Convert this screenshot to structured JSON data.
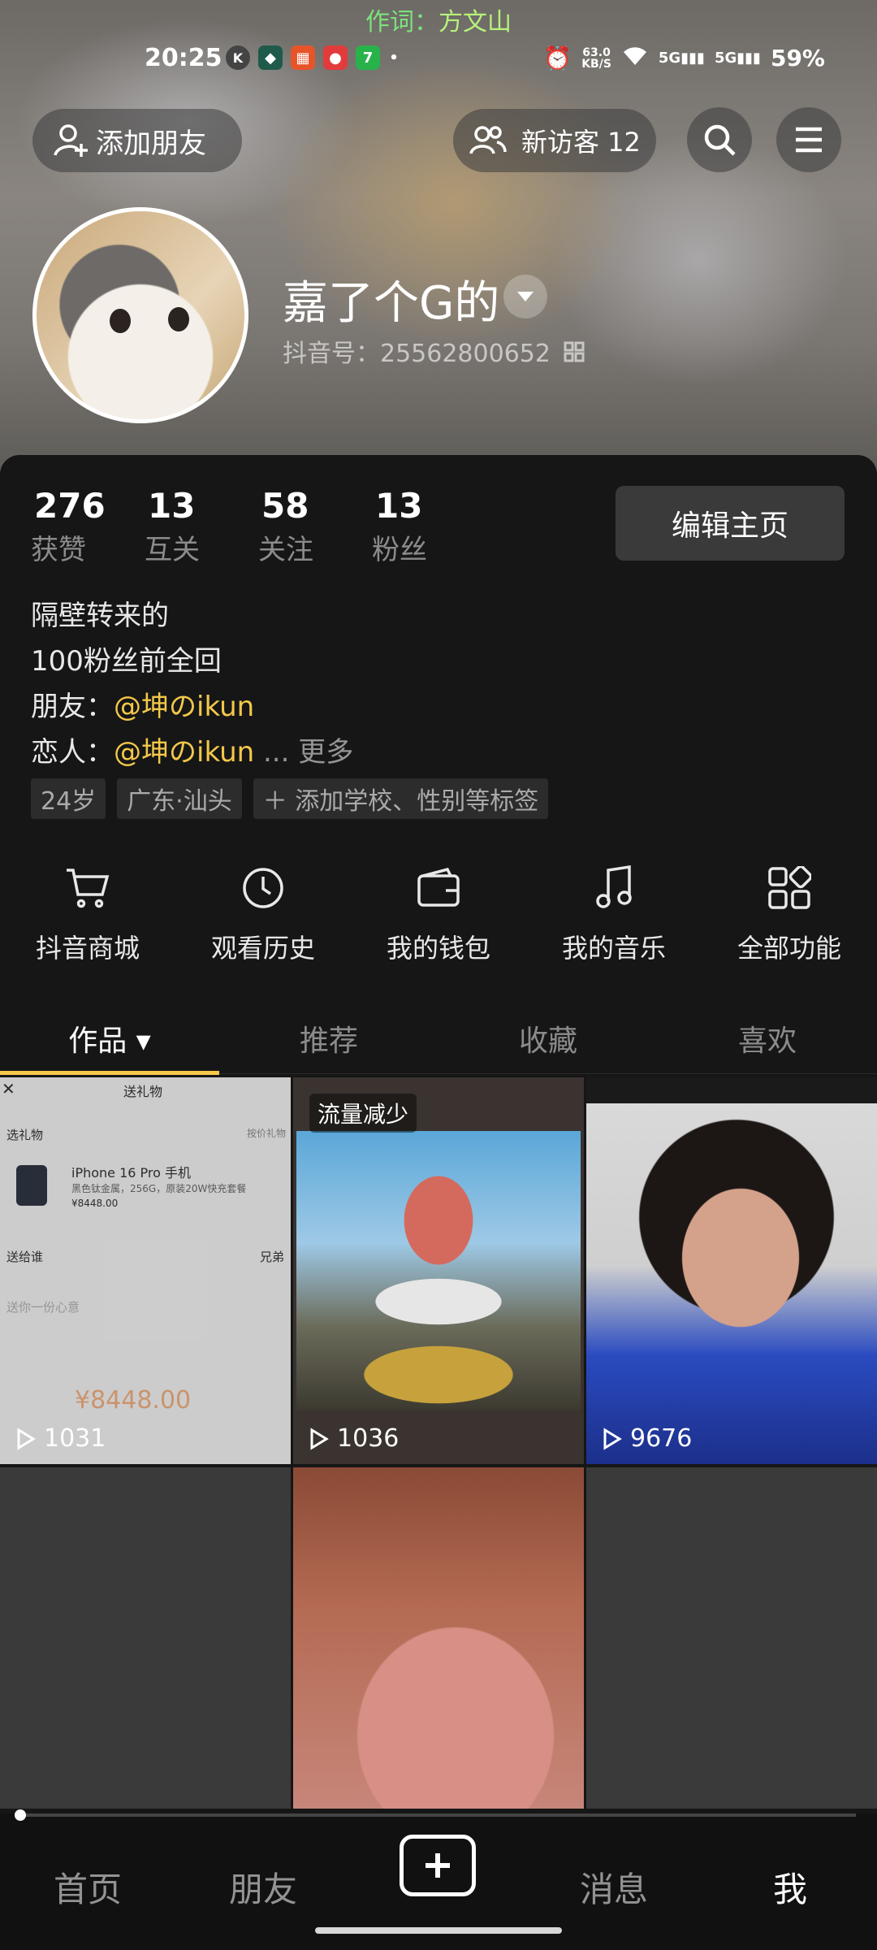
{
  "lyric": {
    "prefix": "作词：",
    "name": "方文山"
  },
  "status_bar": {
    "time": "20:25",
    "net_speed_top": "63.0",
    "net_speed_bottom": "KB/S",
    "sig1": "5G",
    "sig2": "5G",
    "battery": "59%"
  },
  "header": {
    "add_friend": "添加朋友",
    "visitors": "新访客 12"
  },
  "profile": {
    "username": "嘉了个G的",
    "douyin_id_label": "抖音号：",
    "douyin_id": "25562800652"
  },
  "stats": [
    {
      "num": "276",
      "label": "获赞"
    },
    {
      "num": "13",
      "label": "互关"
    },
    {
      "num": "58",
      "label": "关注"
    },
    {
      "num": "13",
      "label": "粉丝"
    }
  ],
  "edit_button": "编辑主页",
  "bio": {
    "line1": "隔壁转来的",
    "line2": "100粉丝前全回",
    "friend_label": "朋友：",
    "friend_handle": "@坤のikun",
    "lover_label": "恋人：",
    "lover_handle": "@坤のikun",
    "ellipsis": "...",
    "more": "更多"
  },
  "tags": [
    "24岁",
    "广东·汕头",
    "＋ 添加学校、性别等标签"
  ],
  "features": [
    {
      "label": "抖音商城",
      "icon": "cart-icon"
    },
    {
      "label": "观看历史",
      "icon": "clock-icon"
    },
    {
      "label": "我的钱包",
      "icon": "wallet-icon"
    },
    {
      "label": "我的音乐",
      "icon": "music-note-icon"
    },
    {
      "label": "全部功能",
      "icon": "grid-icon"
    }
  ],
  "tabs": [
    {
      "label": "作品 ▾"
    },
    {
      "label": "推荐"
    },
    {
      "label": "收藏"
    },
    {
      "label": "喜欢"
    }
  ],
  "videos": [
    {
      "views": "1031",
      "title": "送礼物",
      "sub1": "选礼物",
      "sub1r": "按价礼物",
      "product": "iPhone 16 Pro 手机",
      "spec": "黑色钛金属，256G，原装20W快充套餐",
      "price_small": "¥8448.00",
      "to": "送给谁",
      "to_name": "兄弟",
      "msg": "送你一份心意",
      "price_big": "¥8448.00"
    },
    {
      "views": "1036",
      "badge": "流量减少"
    },
    {
      "views": "9676"
    }
  ],
  "bottom_nav": {
    "home": "首页",
    "friends": "朋友",
    "messages": "消息",
    "me": "我"
  },
  "colors": {
    "accent": "#f6c94a",
    "handle": "#f3c84a",
    "lyric": "#7be37b"
  }
}
